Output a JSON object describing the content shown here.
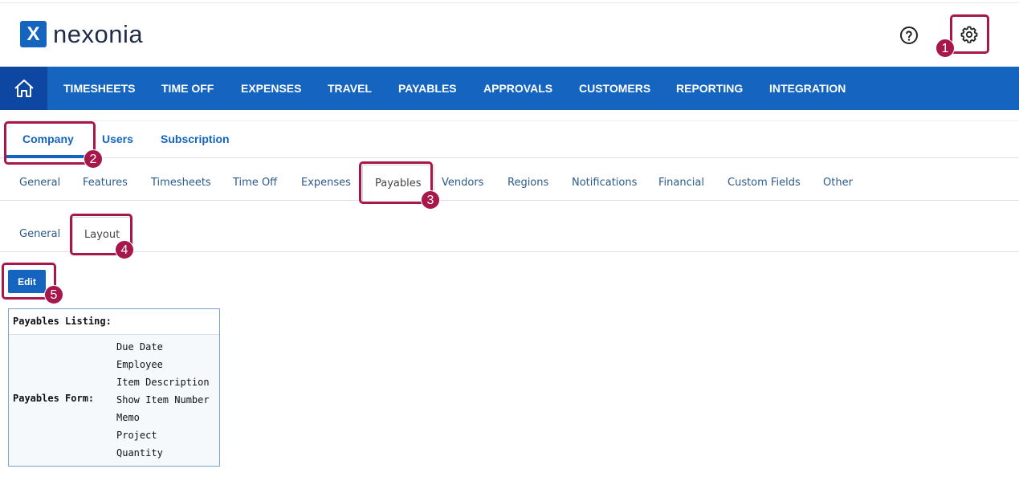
{
  "app": {
    "name": "nexonia",
    "logo_letter": "X",
    "brand_color": "#1565c0",
    "annotation_color": "#a8174a"
  },
  "header": {
    "help_icon": "help-circle-icon",
    "settings_icon": "gear-icon"
  },
  "nav": {
    "home_icon": "home-icon",
    "items": [
      "TIMESHEETS",
      "TIME OFF",
      "EXPENSES",
      "TRAVEL",
      "PAYABLES",
      "APPROVALS",
      "CUSTOMERS",
      "REPORTING",
      "INTEGRATION"
    ]
  },
  "settings_tabs": [
    "Company",
    "Users",
    "Subscription"
  ],
  "company_tabs": [
    "General",
    "Features",
    "Timesheets",
    "Time Off",
    "Expenses",
    "Payables",
    "Vendors",
    "Regions",
    "Notifications",
    "Financial",
    "Custom Fields",
    "Other"
  ],
  "payables_tabs": [
    "General",
    "Layout"
  ],
  "edit_button": "Edit",
  "layout": {
    "listing_label": "Payables Listing:",
    "form_label": "Payables Form:",
    "form_fields": [
      "Due Date",
      "Employee",
      "Item Description",
      "Show Item Number",
      "Memo",
      "Project",
      "Quantity"
    ]
  },
  "annotations": [
    "1",
    "2",
    "3",
    "4",
    "5"
  ]
}
